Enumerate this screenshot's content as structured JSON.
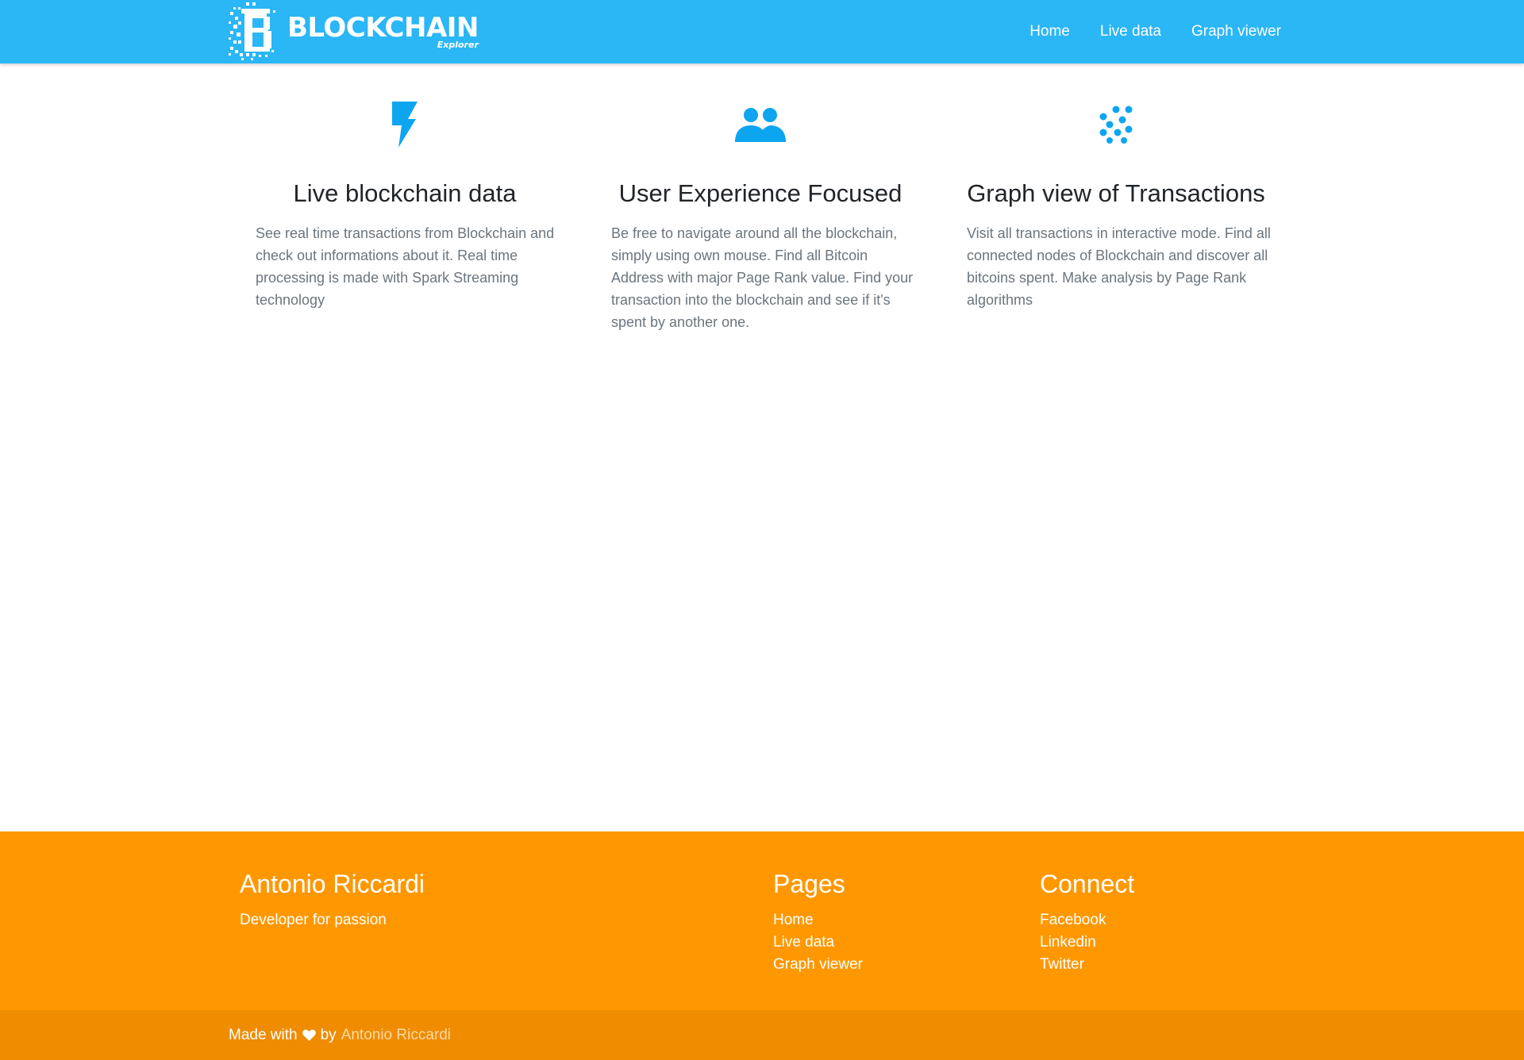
{
  "brand": {
    "title": "BLOCKCHAIN",
    "subtitle": "Explorer",
    "logo_icon": "bitcoin-b-pixel-logo"
  },
  "nav": {
    "items": [
      {
        "label": "Home"
      },
      {
        "label": "Live data"
      },
      {
        "label": "Graph viewer"
      }
    ]
  },
  "features": [
    {
      "icon": "lightning-bolt-icon",
      "title": "Live blockchain data",
      "text": "See real time transactions from Blockchain and check out informations about it. Real time processing is made with Spark Streaming technology"
    },
    {
      "icon": "users-icon",
      "title": "User Experience Focused",
      "text": "Be free to navigate around all the blockchain, simply using own mouse. Find all Bitcoin Address with major Page Rank value. Find your transaction into the blockchain and see if it's spent by another one."
    },
    {
      "icon": "graph-nodes-icon",
      "title": "Graph view of Transactions",
      "text": "Visit all transactions in interactive mode. Find all connected nodes of Blockchain and discover all bitcoins spent. Make analysis by Page Rank algorithms"
    }
  ],
  "footer": {
    "about": {
      "heading": "Antonio Riccardi",
      "text": "Developer for passion"
    },
    "pages": {
      "heading": "Pages",
      "links": [
        "Home",
        "Live data",
        "Graph viewer"
      ]
    },
    "connect": {
      "heading": "Connect",
      "links": [
        "Facebook",
        "Linkedin",
        "Twitter"
      ]
    }
  },
  "copyright": {
    "prefix": "Made with",
    "icon": "heart-icon",
    "by": "by",
    "author": "Antonio Riccardi"
  },
  "colors": {
    "navbar": "#2bb6f6",
    "icon_accent": "#0ea5f0",
    "footer": "#ff9800",
    "copyright_bar": "#ef8c00",
    "author_link": "#ffd9a8"
  }
}
